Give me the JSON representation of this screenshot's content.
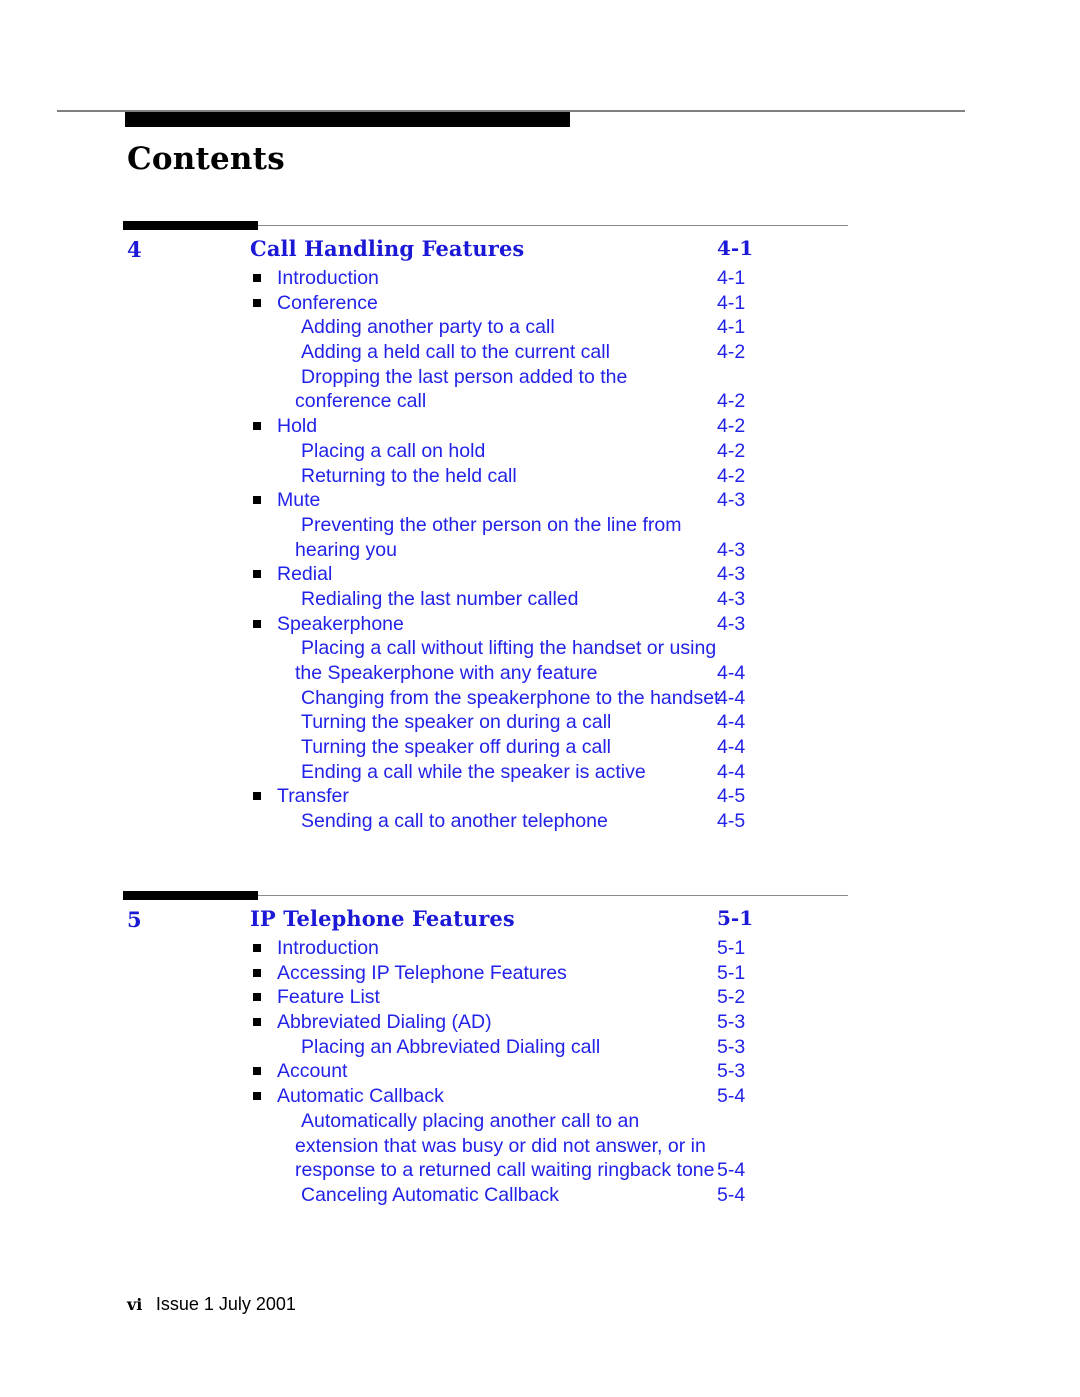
{
  "document": {
    "title": "Contents",
    "colors": {
      "link_blue": "#2222e8",
      "heading_blue": "#1b19d6",
      "rule_gray": "#808080",
      "bar_black": "#000000"
    }
  },
  "footer": {
    "folio": "vi",
    "issue": "Issue  1   July 2001"
  },
  "chapters": [
    {
      "number": "4",
      "title": "Call Handling Features",
      "page": "4-1",
      "entries": [
        {
          "level": 1,
          "label": "Introduction",
          "page": "4-1",
          "lines": 1
        },
        {
          "level": 1,
          "label": "Conference",
          "page": "4-1",
          "lines": 1
        },
        {
          "level": 2,
          "label": "Adding another party to a call",
          "page": "4-1",
          "lines": 1
        },
        {
          "level": 2,
          "label": "Adding a held call to the current call",
          "page": "4-2",
          "lines": 1
        },
        {
          "level": 2,
          "label": "Dropping the last person added to the\nconference call",
          "page": "4-2",
          "lines": 2
        },
        {
          "level": 1,
          "label": "Hold",
          "page": "4-2",
          "lines": 1
        },
        {
          "level": 2,
          "label": "Placing a call on hold",
          "page": "4-2",
          "lines": 1
        },
        {
          "level": 2,
          "label": "Returning to the held call",
          "page": "4-2",
          "lines": 1
        },
        {
          "level": 1,
          "label": "Mute",
          "page": "4-3",
          "lines": 1
        },
        {
          "level": 2,
          "label": "Preventing the other person on the line from\nhearing you",
          "page": "4-3",
          "lines": 2
        },
        {
          "level": 1,
          "label": "Redial",
          "page": "4-3",
          "lines": 1
        },
        {
          "level": 2,
          "label": "Redialing the last number called",
          "page": "4-3",
          "lines": 1
        },
        {
          "level": 1,
          "label": "Speakerphone",
          "page": "4-3",
          "lines": 1
        },
        {
          "level": 2,
          "label": "Placing a call without lifting the handset or using\nthe Speakerphone with any feature",
          "page": "4-4",
          "lines": 2
        },
        {
          "level": 2,
          "label": "Changing from the speakerphone to the handset",
          "page": "4-4",
          "lines": 1
        },
        {
          "level": 2,
          "label": "Turning the speaker on during a call",
          "page": "4-4",
          "lines": 1
        },
        {
          "level": 2,
          "label": "Turning the speaker off during a call",
          "page": "4-4",
          "lines": 1
        },
        {
          "level": 2,
          "label": "Ending a call while the speaker is active",
          "page": "4-4",
          "lines": 1
        },
        {
          "level": 1,
          "label": "Transfer",
          "page": "4-5",
          "lines": 1
        },
        {
          "level": 2,
          "label": "Sending a call to another telephone",
          "page": "4-5",
          "lines": 1
        }
      ]
    },
    {
      "number": "5",
      "title": "IP Telephone Features",
      "page": "5-1",
      "entries": [
        {
          "level": 1,
          "label": "Introduction",
          "page": "5-1",
          "lines": 1
        },
        {
          "level": 1,
          "label": "Accessing IP Telephone Features",
          "page": "5-1",
          "lines": 1
        },
        {
          "level": 1,
          "label": "Feature List",
          "page": "5-2",
          "lines": 1
        },
        {
          "level": 1,
          "label": "Abbreviated Dialing (AD)",
          "page": "5-3",
          "lines": 1
        },
        {
          "level": 2,
          "label": "Placing an Abbreviated Dialing call",
          "page": "5-3",
          "lines": 1
        },
        {
          "level": 1,
          "label": "Account",
          "page": "5-3",
          "lines": 1
        },
        {
          "level": 1,
          "label": "Automatic Callback",
          "page": "5-4",
          "lines": 1
        },
        {
          "level": 2,
          "label": "Automatically placing another call to an\nextension that was busy or did not answer, or in\nresponse to a returned call waiting ringback tone",
          "page": "5-4",
          "lines": 3
        },
        {
          "level": 2,
          "label": "Canceling Automatic Callback",
          "page": "5-4",
          "lines": 1
        }
      ]
    }
  ]
}
